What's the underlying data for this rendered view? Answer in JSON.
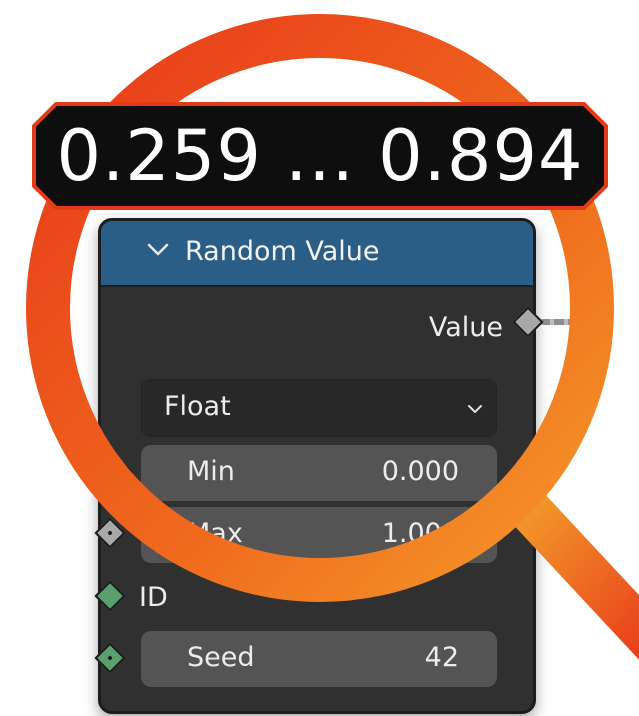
{
  "node": {
    "title": "Random Value",
    "output_label": "Value",
    "data_type": "Float",
    "fields": {
      "min_label": "Min",
      "min_value": "0.000",
      "max_label": "Max",
      "max_value": "1.000",
      "id_label": "ID",
      "seed_label": "Seed",
      "seed_value": "42"
    }
  },
  "readout": {
    "text": "0.259 ... 0.894"
  },
  "colors": {
    "header": "#2a5e86",
    "node_body": "#303030",
    "field": "#545454",
    "socket_gray": "#a8a8a8",
    "socket_green": "#5a9f6d",
    "magnifier": "#f0521a"
  },
  "icons": {
    "collapse": "chevron-down-icon",
    "dropdown": "chevron-down-icon"
  }
}
